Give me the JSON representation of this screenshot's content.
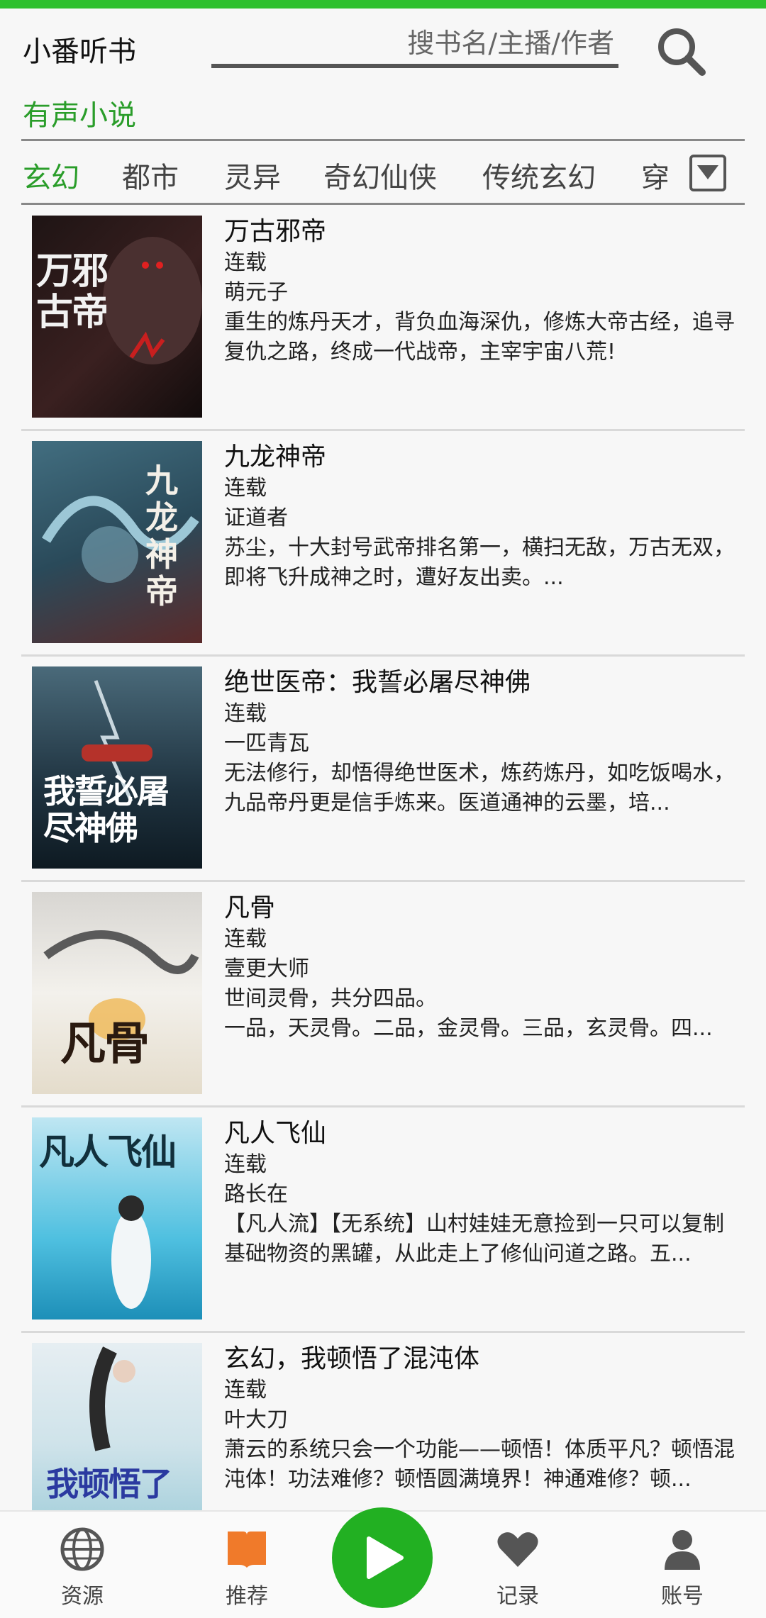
{
  "app": {
    "title": "小番听书",
    "accent": "#2ec02e",
    "section_color": "#2a9d2a"
  },
  "search": {
    "placeholder": "搜书名/主播/作者"
  },
  "section": {
    "title": "有声小说"
  },
  "tabs": [
    {
      "label": "玄幻",
      "active": true
    },
    {
      "label": "都市",
      "active": false
    },
    {
      "label": "灵异",
      "active": false
    },
    {
      "label": "奇幻仙侠",
      "active": false
    },
    {
      "label": "传统玄幻",
      "active": false
    },
    {
      "label": "穿",
      "active": false
    }
  ],
  "books": [
    {
      "title": "万古邪帝",
      "status": "连载",
      "author": "萌元子",
      "desc": "重生的炼丹天才，背负血海深仇，修炼大帝古经，追寻复仇之路，终成一代战帝，主宰宇宙八荒!",
      "cover": {
        "text": "万邪古帝",
        "bg": "#2a1a1a",
        "accent": "#c81f1f"
      }
    },
    {
      "title": "九龙神帝",
      "status": "连载",
      "author": "证道者",
      "desc": "苏尘，十大封号武帝排名第一，横扫无敌，万古无双，即将飞升成神之时，遭好友出卖。...",
      "cover": {
        "text": "九龙神帝",
        "bg": "#2f5a6e",
        "accent": "#b83a2a"
      }
    },
    {
      "title": "绝世医帝：我誓必屠尽神佛",
      "status": "连载",
      "author": "一匹青瓦",
      "desc": "无法修行，却悟得绝世医术，炼药炼丹，如吃饭喝水，九品帝丹更是信手炼来。医道通神的云墨，培...",
      "cover": {
        "text": "我誓必屠尽神佛",
        "bg": "#1f3340",
        "accent": "#ffffff"
      }
    },
    {
      "title": "凡骨",
      "status": "连载",
      "author": "壹更大师",
      "desc": "世间灵骨，共分四品。\n一品，天灵骨。二品，金灵骨。三品，玄灵骨。四...",
      "cover": {
        "text": "凡骨",
        "bg": "#e8e4dc",
        "accent": "#3a2a1a"
      }
    },
    {
      "title": "凡人飞仙",
      "status": "连载",
      "author": "路长在",
      "desc": "【凡人流】【无系统】山村娃娃无意捡到一只可以复制基础物资的黑罐，从此走上了修仙问道之路。五...",
      "cover": {
        "text": "凡人飞仙",
        "bg": "#3fb7d8",
        "accent": "#12303c"
      }
    },
    {
      "title": "玄幻，我顿悟了混沌体",
      "status": "连载",
      "author": "叶大刀",
      "desc": "萧云的系统只会一个功能——顿悟！体质平凡？顿悟混沌体！功法难修？顿悟圆满境界！神通难修？顿...",
      "cover": {
        "text": "我顿悟了",
        "bg": "#cfe3ea",
        "accent": "#2b3aa0"
      }
    }
  ],
  "nav": {
    "items": [
      {
        "label": "资源",
        "icon": "globe-icon"
      },
      {
        "label": "推荐",
        "icon": "book-icon",
        "color": "#f07a2a"
      },
      {
        "label": "记录",
        "icon": "heart-icon"
      },
      {
        "label": "账号",
        "icon": "person-icon"
      }
    ],
    "play_color": "#22b022"
  }
}
